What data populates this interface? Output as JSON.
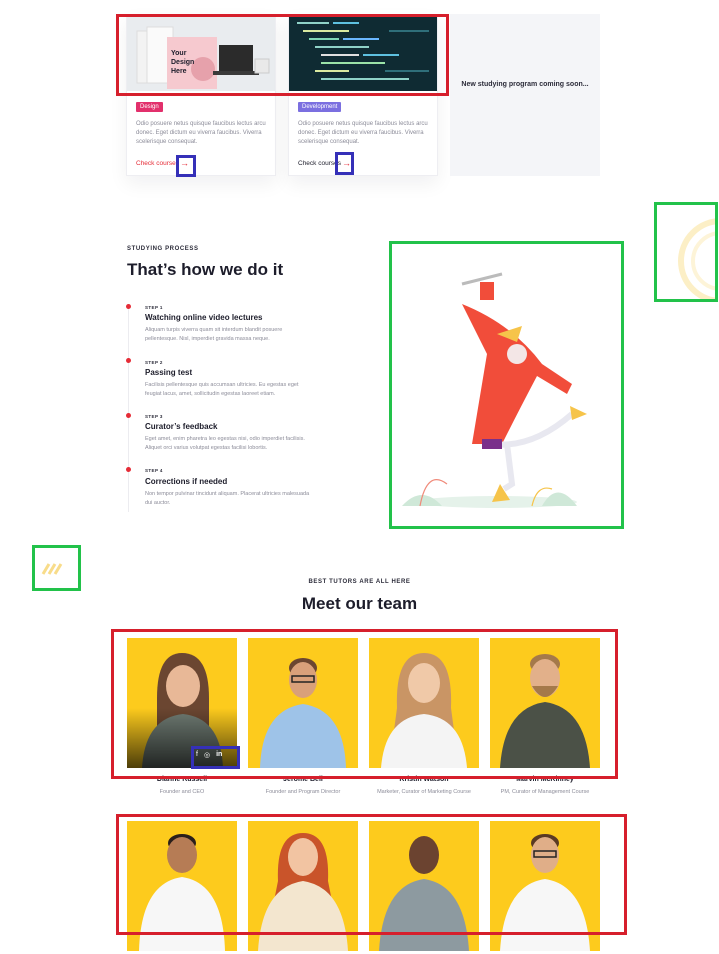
{
  "courses": [
    {
      "tag": "Design",
      "tag_color": "#e2306c",
      "desc": "Odio posuere netus quisque faucibus lectus arcu donec. Eget dictum eu viverra faucibus. Viverra scelerisque consequat.",
      "link": "Check courses",
      "link_color": "#e52c37",
      "thumb_text": "Your Design Here"
    },
    {
      "tag": "Development",
      "tag_color": "#7b6fe0",
      "desc": "Odio posuere netus quisque faucibus lectus arcu donec. Eget dictum eu viverra faucibus. Viverra scelerisque consequat.",
      "link": "Check courses",
      "link_color": "#1d1d2b"
    }
  ],
  "coming_soon": "New studying program coming soon...",
  "process": {
    "eyebrow": "STUDYING PROCESS",
    "title": "That’s how we do it",
    "steps": [
      {
        "label": "STEP 1",
        "title": "Watching online video lectures",
        "text": "Aliquam turpis viverra quam sit interdum blandit posuere pellentesque. Nisl, imperdiet gravida massa neque."
      },
      {
        "label": "STEP 2",
        "title": "Passing test",
        "text": "Facilisis pellentesque quis accumsan ultricies. Eu egestas eget feugiat lacus, amet, sollicitudin egestas laoreet etiam."
      },
      {
        "label": "STEP 3",
        "title": "Curator’s feedback",
        "text": "Eget amet, enim pharetra leo egestas nisi, odio imperdiet facilisis. Aliquet orci varius volutpat egestas facilisi lobortis."
      },
      {
        "label": "STEP 4",
        "title": "Corrections if needed",
        "text": "Non tempor pulvinar tincidunt aliquam. Placerat ultricies malesuada dui auctor."
      }
    ]
  },
  "team": {
    "eyebrow": "BEST TUTORS ARE ALL HERE",
    "title": "Meet our team",
    "members": [
      {
        "name": "Dianne Russell",
        "role": "Founder and CEO"
      },
      {
        "name": "Jerome Bell",
        "role": "Founder and Program Director"
      },
      {
        "name": "Kristin Watson",
        "role": "Marketer, Curator of Marketing Course"
      },
      {
        "name": "Marvin McKinney",
        "role": "PM, Curator of Management Course"
      }
    ],
    "social": [
      "f",
      "◎",
      "in"
    ]
  },
  "colors": {
    "accent": "#e52c37",
    "tutor_bg": "#fdcb1d",
    "red_box": "#d61f2c",
    "green_box": "#22c24a",
    "blue_box": "#3530b8"
  }
}
